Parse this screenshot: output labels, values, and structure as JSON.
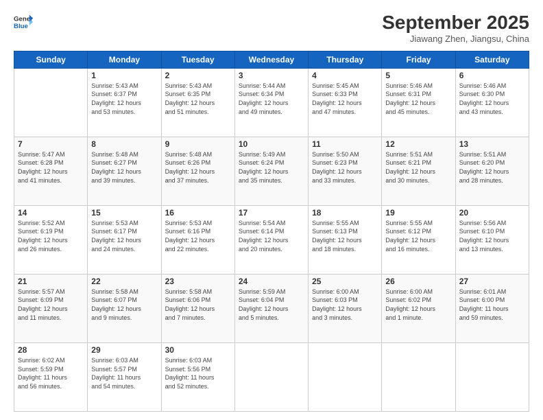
{
  "logo": {
    "line1": "General",
    "line2": "Blue"
  },
  "title": "September 2025",
  "location": "Jiawang Zhen, Jiangsu, China",
  "weekdays": [
    "Sunday",
    "Monday",
    "Tuesday",
    "Wednesday",
    "Thursday",
    "Friday",
    "Saturday"
  ],
  "weeks": [
    [
      {
        "day": "",
        "info": ""
      },
      {
        "day": "1",
        "info": "Sunrise: 5:43 AM\nSunset: 6:37 PM\nDaylight: 12 hours\nand 53 minutes."
      },
      {
        "day": "2",
        "info": "Sunrise: 5:43 AM\nSunset: 6:35 PM\nDaylight: 12 hours\nand 51 minutes."
      },
      {
        "day": "3",
        "info": "Sunrise: 5:44 AM\nSunset: 6:34 PM\nDaylight: 12 hours\nand 49 minutes."
      },
      {
        "day": "4",
        "info": "Sunrise: 5:45 AM\nSunset: 6:33 PM\nDaylight: 12 hours\nand 47 minutes."
      },
      {
        "day": "5",
        "info": "Sunrise: 5:46 AM\nSunset: 6:31 PM\nDaylight: 12 hours\nand 45 minutes."
      },
      {
        "day": "6",
        "info": "Sunrise: 5:46 AM\nSunset: 6:30 PM\nDaylight: 12 hours\nand 43 minutes."
      }
    ],
    [
      {
        "day": "7",
        "info": "Sunrise: 5:47 AM\nSunset: 6:28 PM\nDaylight: 12 hours\nand 41 minutes."
      },
      {
        "day": "8",
        "info": "Sunrise: 5:48 AM\nSunset: 6:27 PM\nDaylight: 12 hours\nand 39 minutes."
      },
      {
        "day": "9",
        "info": "Sunrise: 5:48 AM\nSunset: 6:26 PM\nDaylight: 12 hours\nand 37 minutes."
      },
      {
        "day": "10",
        "info": "Sunrise: 5:49 AM\nSunset: 6:24 PM\nDaylight: 12 hours\nand 35 minutes."
      },
      {
        "day": "11",
        "info": "Sunrise: 5:50 AM\nSunset: 6:23 PM\nDaylight: 12 hours\nand 33 minutes."
      },
      {
        "day": "12",
        "info": "Sunrise: 5:51 AM\nSunset: 6:21 PM\nDaylight: 12 hours\nand 30 minutes."
      },
      {
        "day": "13",
        "info": "Sunrise: 5:51 AM\nSunset: 6:20 PM\nDaylight: 12 hours\nand 28 minutes."
      }
    ],
    [
      {
        "day": "14",
        "info": "Sunrise: 5:52 AM\nSunset: 6:19 PM\nDaylight: 12 hours\nand 26 minutes."
      },
      {
        "day": "15",
        "info": "Sunrise: 5:53 AM\nSunset: 6:17 PM\nDaylight: 12 hours\nand 24 minutes."
      },
      {
        "day": "16",
        "info": "Sunrise: 5:53 AM\nSunset: 6:16 PM\nDaylight: 12 hours\nand 22 minutes."
      },
      {
        "day": "17",
        "info": "Sunrise: 5:54 AM\nSunset: 6:14 PM\nDaylight: 12 hours\nand 20 minutes."
      },
      {
        "day": "18",
        "info": "Sunrise: 5:55 AM\nSunset: 6:13 PM\nDaylight: 12 hours\nand 18 minutes."
      },
      {
        "day": "19",
        "info": "Sunrise: 5:55 AM\nSunset: 6:12 PM\nDaylight: 12 hours\nand 16 minutes."
      },
      {
        "day": "20",
        "info": "Sunrise: 5:56 AM\nSunset: 6:10 PM\nDaylight: 12 hours\nand 13 minutes."
      }
    ],
    [
      {
        "day": "21",
        "info": "Sunrise: 5:57 AM\nSunset: 6:09 PM\nDaylight: 12 hours\nand 11 minutes."
      },
      {
        "day": "22",
        "info": "Sunrise: 5:58 AM\nSunset: 6:07 PM\nDaylight: 12 hours\nand 9 minutes."
      },
      {
        "day": "23",
        "info": "Sunrise: 5:58 AM\nSunset: 6:06 PM\nDaylight: 12 hours\nand 7 minutes."
      },
      {
        "day": "24",
        "info": "Sunrise: 5:59 AM\nSunset: 6:04 PM\nDaylight: 12 hours\nand 5 minutes."
      },
      {
        "day": "25",
        "info": "Sunrise: 6:00 AM\nSunset: 6:03 PM\nDaylight: 12 hours\nand 3 minutes."
      },
      {
        "day": "26",
        "info": "Sunrise: 6:00 AM\nSunset: 6:02 PM\nDaylight: 12 hours\nand 1 minute."
      },
      {
        "day": "27",
        "info": "Sunrise: 6:01 AM\nSunset: 6:00 PM\nDaylight: 11 hours\nand 59 minutes."
      }
    ],
    [
      {
        "day": "28",
        "info": "Sunrise: 6:02 AM\nSunset: 5:59 PM\nDaylight: 11 hours\nand 56 minutes."
      },
      {
        "day": "29",
        "info": "Sunrise: 6:03 AM\nSunset: 5:57 PM\nDaylight: 11 hours\nand 54 minutes."
      },
      {
        "day": "30",
        "info": "Sunrise: 6:03 AM\nSunset: 5:56 PM\nDaylight: 11 hours\nand 52 minutes."
      },
      {
        "day": "",
        "info": ""
      },
      {
        "day": "",
        "info": ""
      },
      {
        "day": "",
        "info": ""
      },
      {
        "day": "",
        "info": ""
      }
    ]
  ]
}
